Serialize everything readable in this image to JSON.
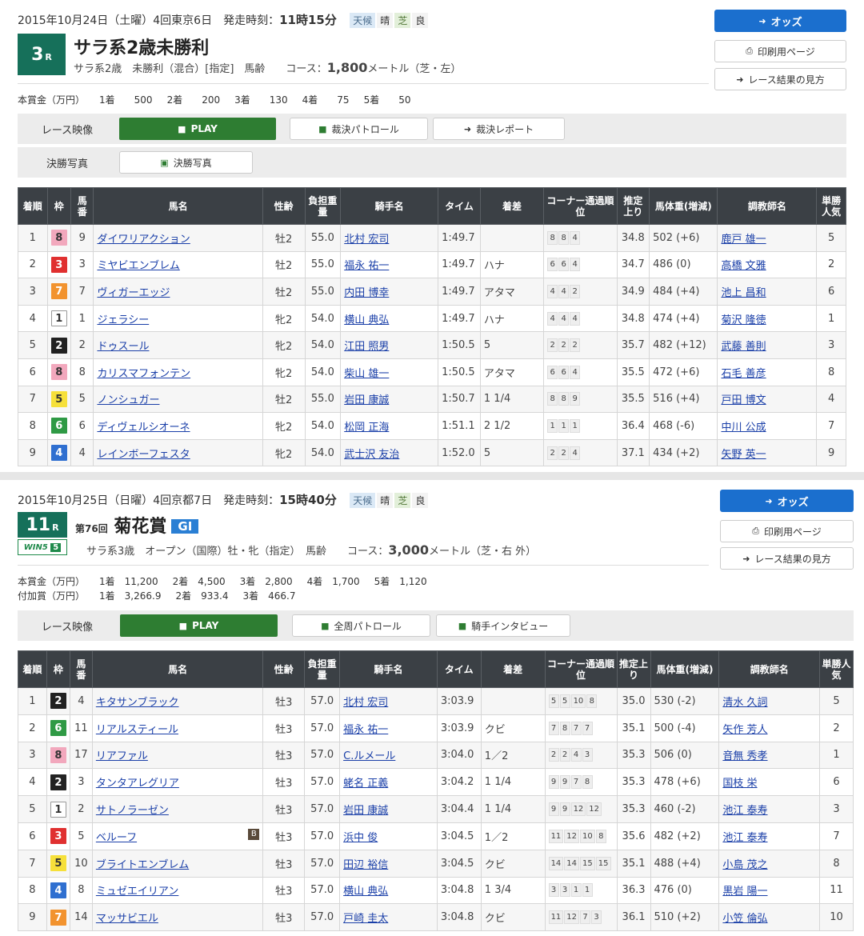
{
  "race1": {
    "date": "2015年10月24日（土曜）4回東京6日",
    "start_label": "発走時刻：",
    "start_time": "11時15分",
    "weather_label": "天候",
    "weather": "晴",
    "track_label": "芝",
    "track_cond": "良",
    "race_no": "3",
    "race_suffix": "R",
    "title": "サラ系2歳未勝利",
    "conditions": "サラ系2歳　未勝利（混合）[指定]　馬齢　　コース：",
    "distance": "1,800",
    "distance_unit": "メートル（芝・左）",
    "prize_label": "本賞金（万円）",
    "prizes": [
      "1着　　500",
      "2着　　200",
      "3着　　130",
      "4着　　75",
      "5着　　50"
    ],
    "odds_button": "オッズ",
    "print_button": "印刷用ページ",
    "howto_button": "レース結果の見方",
    "video_label": "レース映像",
    "play_button": "PLAY",
    "patrol_button": "裁決パトロール",
    "report_button": "裁決レポート",
    "photo_label": "決勝写真",
    "photo_button": "決勝写真",
    "headers": [
      "着順",
      "枠",
      "馬番",
      "馬名",
      "性齢",
      "負担重量",
      "騎手名",
      "タイム",
      "着差",
      "コーナー通過順位",
      "推定上り",
      "馬体重(増減)",
      "調教師名",
      "単勝人気"
    ],
    "rows": [
      {
        "rank": "1",
        "frame": "8",
        "num": "9",
        "horse": "ダイワリアクション",
        "sex": "牡2",
        "wt": "55.0",
        "jockey": "北村 宏司",
        "time": "1:49.7",
        "margin": "",
        "corner": [
          "8",
          "8",
          "4"
        ],
        "last": "34.8",
        "bw": "502 (+6)",
        "trainer": "鹿戸 雄一",
        "pop": "5"
      },
      {
        "rank": "2",
        "frame": "3",
        "num": "3",
        "horse": "ミヤビエンブレム",
        "sex": "牡2",
        "wt": "55.0",
        "jockey": "福永 祐一",
        "time": "1:49.7",
        "margin": "ハナ",
        "corner": [
          "6",
          "6",
          "4"
        ],
        "last": "34.7",
        "bw": "486 (0)",
        "trainer": "高橋 文雅",
        "pop": "2"
      },
      {
        "rank": "3",
        "frame": "7",
        "num": "7",
        "horse": "ヴィガーエッジ",
        "sex": "牡2",
        "wt": "55.0",
        "jockey": "内田 博幸",
        "time": "1:49.7",
        "margin": "アタマ",
        "corner": [
          "4",
          "4",
          "2"
        ],
        "last": "34.9",
        "bw": "484 (+4)",
        "trainer": "池上 昌和",
        "pop": "6"
      },
      {
        "rank": "4",
        "frame": "1",
        "num": "1",
        "horse": "ジェラシー",
        "sex": "牝2",
        "wt": "54.0",
        "jockey": "横山 典弘",
        "time": "1:49.7",
        "margin": "ハナ",
        "corner": [
          "4",
          "4",
          "4"
        ],
        "last": "34.8",
        "bw": "474 (+4)",
        "trainer": "菊沢 隆徳",
        "pop": "1"
      },
      {
        "rank": "5",
        "frame": "2",
        "num": "2",
        "horse": "ドゥスール",
        "sex": "牝2",
        "wt": "54.0",
        "jockey": "江田 照男",
        "time": "1:50.5",
        "margin": "5",
        "corner": [
          "2",
          "2",
          "2"
        ],
        "last": "35.7",
        "bw": "482 (+12)",
        "trainer": "武藤 善則",
        "pop": "3"
      },
      {
        "rank": "6",
        "frame": "8",
        "num": "8",
        "horse": "カリスマフォンテン",
        "sex": "牝2",
        "wt": "54.0",
        "jockey": "柴山 雄一",
        "time": "1:50.5",
        "margin": "アタマ",
        "corner": [
          "6",
          "6",
          "4"
        ],
        "last": "35.5",
        "bw": "472 (+6)",
        "trainer": "石毛 善彦",
        "pop": "8"
      },
      {
        "rank": "7",
        "frame": "5",
        "num": "5",
        "horse": "ノンシュガー",
        "sex": "牡2",
        "wt": "55.0",
        "jockey": "岩田 康誠",
        "time": "1:50.7",
        "margin": "1 1/4",
        "corner": [
          "8",
          "8",
          "9"
        ],
        "last": "35.5",
        "bw": "516 (+4)",
        "trainer": "戸田 博文",
        "pop": "4"
      },
      {
        "rank": "8",
        "frame": "6",
        "num": "6",
        "horse": "ディヴェルシオーネ",
        "sex": "牝2",
        "wt": "54.0",
        "jockey": "松岡 正海",
        "time": "1:51.1",
        "margin": "2 1/2",
        "corner": [
          "1",
          "1",
          "1"
        ],
        "last": "36.4",
        "bw": "468 (-6)",
        "trainer": "中川 公成",
        "pop": "7"
      },
      {
        "rank": "9",
        "frame": "4",
        "num": "4",
        "horse": "レインボーフェスタ",
        "sex": "牝2",
        "wt": "54.0",
        "jockey": "武士沢 友治",
        "time": "1:52.0",
        "margin": "5",
        "corner": [
          "2",
          "2",
          "4"
        ],
        "last": "37.1",
        "bw": "434 (+2)",
        "trainer": "矢野 英一",
        "pop": "9"
      }
    ]
  },
  "race2": {
    "date": "2015年10月25日（日曜）4回京都7日",
    "start_label": "発走時刻：",
    "start_time": "15時40分",
    "weather_label": "天候",
    "weather": "晴",
    "track_label": "芝",
    "track_cond": "良",
    "race_no": "11",
    "race_suffix": "R",
    "win5": "WIN5",
    "win5_no": "5",
    "kai": "第76回",
    "title": "菊花賞",
    "grade": "GI",
    "conditions": "サラ系3歳　オープン（国際）牡・牝（指定）　馬齢　　コース：",
    "distance": "3,000",
    "distance_unit": "メートル（芝・右 外）",
    "prize_label": "本賞金（万円）",
    "prizes": [
      "1着　11,200",
      "2着　4,500",
      "3着　2,800",
      "4着　1,700",
      "5着　1,120"
    ],
    "add_prize_label": "付加賞（万円）",
    "add_prizes": [
      "1着　3,266.9",
      "2着　933.4",
      "3着　466.7"
    ],
    "odds_button": "オッズ",
    "print_button": "印刷用ページ",
    "howto_button": "レース結果の見方",
    "video_label": "レース映像",
    "play_button": "PLAY",
    "patrol_button": "全周パトロール",
    "interview_button": "騎手インタビュー",
    "headers": [
      "着順",
      "枠",
      "馬番",
      "馬名",
      "性齢",
      "負担重量",
      "騎手名",
      "タイム",
      "着差",
      "コーナー通過順位",
      "推定上り",
      "馬体重(増減)",
      "調教師名",
      "単勝人気"
    ],
    "rows": [
      {
        "rank": "1",
        "frame": "2",
        "num": "4",
        "horse": "キタサンブラック",
        "b": "",
        "sex": "牡3",
        "wt": "57.0",
        "jockey": "北村 宏司",
        "time": "3:03.9",
        "margin": "",
        "corner": [
          "5",
          "5",
          "10",
          "8"
        ],
        "last": "35.0",
        "bw": "530 (-2)",
        "trainer": "清水 久詞",
        "pop": "5"
      },
      {
        "rank": "2",
        "frame": "6",
        "num": "11",
        "horse": "リアルスティール",
        "b": "",
        "sex": "牡3",
        "wt": "57.0",
        "jockey": "福永 祐一",
        "time": "3:03.9",
        "margin": "クビ",
        "corner": [
          "7",
          "8",
          "7",
          "7"
        ],
        "last": "35.1",
        "bw": "500 (-4)",
        "trainer": "矢作 芳人",
        "pop": "2"
      },
      {
        "rank": "3",
        "frame": "8",
        "num": "17",
        "horse": "リアファル",
        "b": "",
        "sex": "牡3",
        "wt": "57.0",
        "jockey": "C.ルメール",
        "time": "3:04.0",
        "margin": "1／2",
        "corner": [
          "2",
          "2",
          "4",
          "3"
        ],
        "last": "35.3",
        "bw": "506 (0)",
        "trainer": "音無 秀孝",
        "pop": "1"
      },
      {
        "rank": "4",
        "frame": "2",
        "num": "3",
        "horse": "タンタアレグリア",
        "b": "",
        "sex": "牡3",
        "wt": "57.0",
        "jockey": "蛯名 正義",
        "time": "3:04.2",
        "margin": "1 1/4",
        "corner": [
          "9",
          "9",
          "7",
          "8"
        ],
        "last": "35.3",
        "bw": "478 (+6)",
        "trainer": "国枝 栄",
        "pop": "6"
      },
      {
        "rank": "5",
        "frame": "1",
        "num": "2",
        "horse": "サトノラーゼン",
        "b": "",
        "sex": "牡3",
        "wt": "57.0",
        "jockey": "岩田 康誠",
        "time": "3:04.4",
        "margin": "1 1/4",
        "corner": [
          "9",
          "9",
          "12",
          "12"
        ],
        "last": "35.3",
        "bw": "460 (-2)",
        "trainer": "池江 泰寿",
        "pop": "3"
      },
      {
        "rank": "6",
        "frame": "3",
        "num": "5",
        "horse": "ベルーフ",
        "b": "B",
        "sex": "牡3",
        "wt": "57.0",
        "jockey": "浜中 俊",
        "time": "3:04.5",
        "margin": "1／2",
        "corner": [
          "11",
          "12",
          "10",
          "8"
        ],
        "last": "35.6",
        "bw": "482 (+2)",
        "trainer": "池江 泰寿",
        "pop": "7"
      },
      {
        "rank": "7",
        "frame": "5",
        "num": "10",
        "horse": "ブライトエンブレム",
        "b": "",
        "sex": "牡3",
        "wt": "57.0",
        "jockey": "田辺 裕信",
        "time": "3:04.5",
        "margin": "クビ",
        "corner": [
          "14",
          "14",
          "15",
          "15"
        ],
        "last": "35.1",
        "bw": "488 (+4)",
        "trainer": "小島 茂之",
        "pop": "8"
      },
      {
        "rank": "8",
        "frame": "4",
        "num": "8",
        "horse": "ミュゼエイリアン",
        "b": "",
        "sex": "牡3",
        "wt": "57.0",
        "jockey": "横山 典弘",
        "time": "3:04.8",
        "margin": "1 3/4",
        "corner": [
          "3",
          "3",
          "1",
          "1"
        ],
        "last": "36.3",
        "bw": "476 (0)",
        "trainer": "黒岩 陽一",
        "pop": "11"
      },
      {
        "rank": "9",
        "frame": "7",
        "num": "14",
        "horse": "マッサビエル",
        "b": "",
        "sex": "牡3",
        "wt": "57.0",
        "jockey": "戸崎 圭太",
        "time": "3:04.8",
        "margin": "クビ",
        "corner": [
          "11",
          "12",
          "7",
          "3"
        ],
        "last": "36.1",
        "bw": "510 (+2)",
        "trainer": "小笠 倫弘",
        "pop": "10"
      }
    ]
  },
  "frame_colors": {
    "1": {
      "bg": "#ffffff",
      "fg": "#333333",
      "border": "#999999"
    },
    "2": {
      "bg": "#222222",
      "fg": "#ffffff",
      "border": "#222222"
    },
    "3": {
      "bg": "#e03030",
      "fg": "#ffffff",
      "border": "#e03030"
    },
    "4": {
      "bg": "#2f6fd0",
      "fg": "#ffffff",
      "border": "#2f6fd0"
    },
    "5": {
      "bg": "#f6e03a",
      "fg": "#333333",
      "border": "#f6e03a"
    },
    "6": {
      "bg": "#2f9a45",
      "fg": "#ffffff",
      "border": "#2f9a45"
    },
    "7": {
      "bg": "#f2932f",
      "fg": "#ffffff",
      "border": "#f2932f"
    },
    "8": {
      "bg": "#f2a8bd",
      "fg": "#333333",
      "border": "#f2a8bd"
    }
  },
  "icons": {
    "odds": "circle-arrow-icon",
    "print": "printer-icon",
    "howto": "circle-arrow-icon",
    "play": "video-camera-icon",
    "photo": "image-icon"
  }
}
